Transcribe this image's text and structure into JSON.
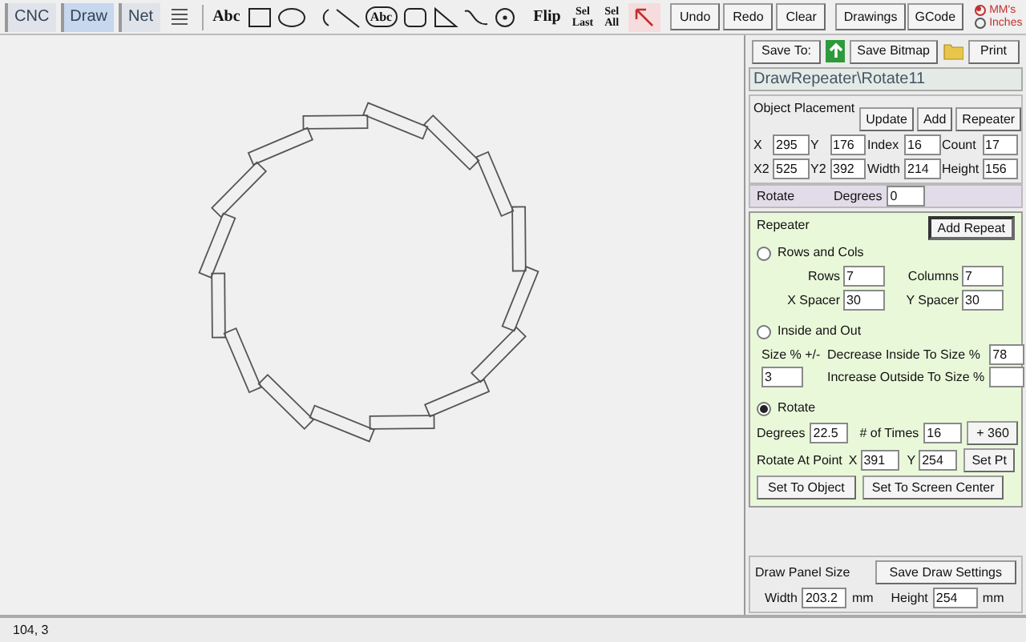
{
  "tabs": [
    {
      "label": "CNC",
      "selected": false
    },
    {
      "label": "Draw",
      "selected": true
    },
    {
      "label": "Net",
      "selected": false
    }
  ],
  "tools": [
    {
      "kind": "text",
      "label": "Abc"
    },
    {
      "kind": "rect"
    },
    {
      "kind": "ellipse"
    },
    {
      "kind": "arc"
    },
    {
      "kind": "line"
    },
    {
      "kind": "circle-text",
      "label": "Abc"
    },
    {
      "kind": "rounded-rect"
    },
    {
      "kind": "triangle"
    },
    {
      "kind": "curve"
    },
    {
      "kind": "target"
    }
  ],
  "flip": "Flip",
  "sel_last": [
    "Sel",
    "Last"
  ],
  "sel_all": [
    "Sel",
    "All"
  ],
  "edit_buttons": [
    "Undo",
    "Redo",
    "Clear"
  ],
  "file_buttons": [
    "Drawings",
    "GCode"
  ],
  "units": [
    {
      "label": "MM's",
      "selected": true
    },
    {
      "label": "Inches",
      "selected": false
    }
  ],
  "panel": {
    "save_to": "Save To:",
    "save_bitmap": "Save Bitmap",
    "print": "Print",
    "file_name": "DrawRepeater\\Rotate11",
    "object_placement": {
      "title": "Object Placement",
      "buttons": [
        "Update",
        "Add",
        "Repeater"
      ],
      "fields": [
        {
          "label": "X",
          "value": "295"
        },
        {
          "label": "Y",
          "value": "176"
        },
        {
          "label": "Index",
          "value": "16"
        },
        {
          "label": "Count",
          "value": "17"
        },
        {
          "label": "X2",
          "value": "525"
        },
        {
          "label": "Y2",
          "value": "392"
        },
        {
          "label": "Width",
          "value": "214"
        },
        {
          "label": "Height",
          "value": "156"
        }
      ]
    },
    "rotate": {
      "title": "Rotate",
      "label": "Degrees",
      "value": "0"
    },
    "repeater": {
      "title": "Repeater",
      "add_button": "Add Repeat",
      "modes": [
        {
          "label": "Rows and Cols",
          "selected": false
        },
        {
          "label": "Inside and Out",
          "selected": false
        },
        {
          "label": "Rotate",
          "selected": true
        }
      ],
      "rows": {
        "label": "Rows",
        "value": "7"
      },
      "columns": {
        "label": "Columns",
        "value": "7"
      },
      "x_spacer": {
        "label": "X Spacer",
        "value": "30"
      },
      "y_spacer": {
        "label": "Y Spacer",
        "value": "30"
      },
      "size": {
        "label": "Size % +/-",
        "value": "3"
      },
      "decrease": {
        "label": "Decrease Inside To Size %",
        "value": "78"
      },
      "increase": {
        "label": "Increase Outside To Size %"
      },
      "degrees": {
        "label": "Degrees",
        "value": "22.5"
      },
      "times": {
        "label": "# of Times",
        "value": "16"
      },
      "plus360": "+ 360",
      "rotate_at": "Rotate At Point",
      "point_x": {
        "label": "X",
        "value": "391"
      },
      "point_y": {
        "label": "Y",
        "value": "254"
      },
      "set_pt": "Set Pt",
      "set_object": "Set To Object",
      "set_center": "Set To Screen Center"
    },
    "draw_panel": {
      "title": "Draw Panel Size",
      "save": "Save Draw Settings",
      "width": {
        "label": "Width",
        "value": "203.2",
        "unit": "mm"
      },
      "height": {
        "label": "Height",
        "value": "254",
        "unit": "mm"
      }
    }
  },
  "status_bar": "104, 3"
}
